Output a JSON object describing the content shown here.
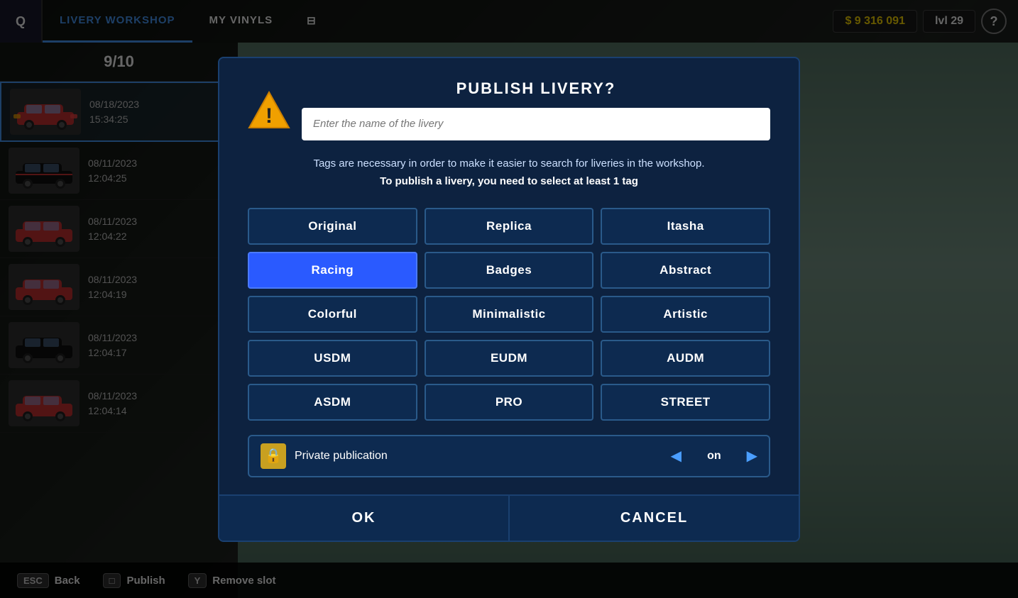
{
  "topbar": {
    "q_key": "Q",
    "nav_items": [
      {
        "label": "LIVERY WORKSHOP",
        "active": true
      },
      {
        "label": "MY VINYLS",
        "active": false
      }
    ],
    "currency": "$ 9 316 091",
    "level": "lvl 29",
    "help": "?"
  },
  "sidebar": {
    "count": "9/10",
    "items": [
      {
        "date": "08/18/2023",
        "time": "15:34:25",
        "selected": true,
        "has_download": false
      },
      {
        "date": "08/11/2023",
        "time": "12:04:25",
        "selected": false,
        "has_download": true
      },
      {
        "date": "08/11/2023",
        "time": "12:04:22",
        "selected": false,
        "has_download": true
      },
      {
        "date": "08/11/2023",
        "time": "12:04:19",
        "selected": false,
        "has_download": true
      },
      {
        "date": "08/11/2023",
        "time": "12:04:17",
        "selected": false,
        "has_download": true
      },
      {
        "date": "08/11/2023",
        "time": "12:04:14",
        "selected": false,
        "has_download": true
      }
    ]
  },
  "bottom_bar": {
    "buttons": [
      {
        "key": "ESC",
        "label": "Back"
      },
      {
        "key": "□",
        "label": "Publish"
      },
      {
        "key": "Y",
        "label": "Remove slot"
      }
    ]
  },
  "dialog": {
    "title": "PUBLISH LIVERY?",
    "name_placeholder": "Enter the name of the livery",
    "description_line1": "Tags are necessary in order to make it easier to search for liveries in the workshop.",
    "description_line2": "To publish a livery, you need to select at least 1 tag",
    "tags": [
      {
        "label": "Original",
        "selected": false
      },
      {
        "label": "Replica",
        "selected": false
      },
      {
        "label": "Itasha",
        "selected": false
      },
      {
        "label": "Racing",
        "selected": true
      },
      {
        "label": "Badges",
        "selected": false
      },
      {
        "label": "Abstract",
        "selected": false
      },
      {
        "label": "Colorful",
        "selected": false
      },
      {
        "label": "Minimalistic",
        "selected": false
      },
      {
        "label": "Artistic",
        "selected": false
      },
      {
        "label": "USDM",
        "selected": false
      },
      {
        "label": "EUDM",
        "selected": false
      },
      {
        "label": "AUDM",
        "selected": false
      },
      {
        "label": "ASDM",
        "selected": false
      },
      {
        "label": "PRO",
        "selected": false
      },
      {
        "label": "STREET",
        "selected": false
      }
    ],
    "private_label": "Private publication",
    "toggle_value": "on",
    "ok_label": "OK",
    "cancel_label": "CANCEL"
  }
}
